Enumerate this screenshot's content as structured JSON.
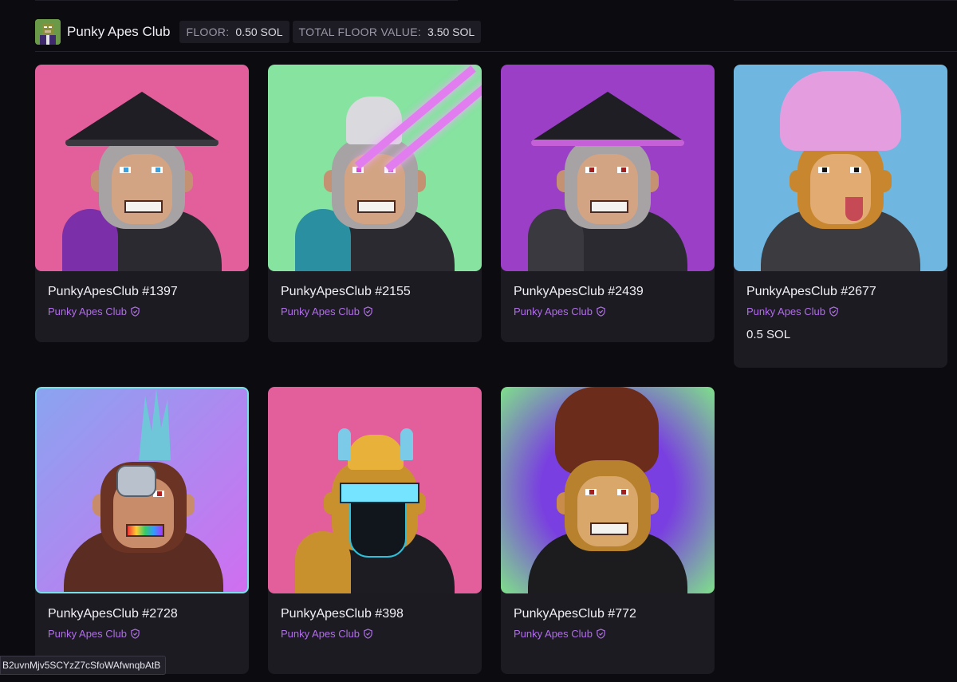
{
  "collection": {
    "name": "Punky Apes Club",
    "floor_label": "FLOOR:",
    "floor_value": "0.50 SOL",
    "total_floor_label": "TOTAL FLOOR VALUE:",
    "total_floor_value": "3.50 SOL"
  },
  "cards": [
    {
      "title": "PunkyApesClub #1397",
      "collection": "Punky Apes Club",
      "price": "",
      "bg": "#e35f9c"
    },
    {
      "title": "PunkyApesClub #2155",
      "collection": "Punky Apes Club",
      "price": "",
      "bg": "#86e3a0"
    },
    {
      "title": "PunkyApesClub #2439",
      "collection": "Punky Apes Club",
      "price": "",
      "bg": "#9a3fc6"
    },
    {
      "title": "PunkyApesClub #2677",
      "collection": "Punky Apes Club",
      "price": "0.5 SOL",
      "bg": "#6fb6e0"
    },
    {
      "title": "PunkyApesClub #2728",
      "collection": "Punky Apes Club",
      "price": "",
      "bg": "#b86bf0"
    },
    {
      "title": "PunkyApesClub #398",
      "collection": "Punky Apes Club",
      "price": "",
      "bg": "#e35f9c"
    },
    {
      "title": "PunkyApesClub #772",
      "collection": "Punky Apes Club",
      "price": "",
      "bg": "#8b55e0"
    }
  ],
  "tooltip": "B2uvnMjv5SCYzZ7cSfoWAfwnqbAtB",
  "colors": {
    "background": "#0c0b10",
    "card": "#1c1b22",
    "accent_purple": "#b06ee8"
  }
}
